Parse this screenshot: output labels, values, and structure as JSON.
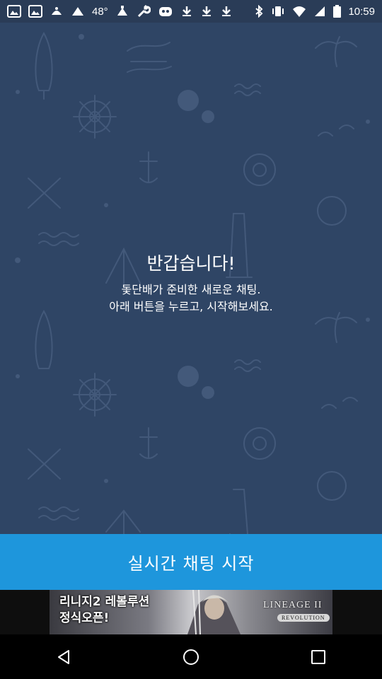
{
  "status_bar": {
    "left_icons": [
      "image-icon",
      "image-icon",
      "weather-icon",
      "weather-icon"
    ],
    "temperature": "48°",
    "more_icons": [
      "weather-icon",
      "wrench-icon",
      "mask-icon",
      "download-icon",
      "download-icon",
      "download-icon"
    ],
    "right_icons": [
      "bluetooth-icon",
      "vibrate-icon",
      "wifi-icon",
      "signal-icon",
      "battery-icon"
    ],
    "time": "10:59"
  },
  "welcome": {
    "title": "반갑습니다!",
    "line1": "돛단배가 준비한 새로운 채팅.",
    "line2": "아래 버튼을 누르고, 시작해보세요."
  },
  "start_button": {
    "label": "실시간 채팅 시작"
  },
  "ad": {
    "headline1": "리니지2 레볼루션",
    "headline2": "정식오픈!",
    "logo": "LINEAGE II",
    "logo_sub": "REVOLUTION"
  },
  "nav": {
    "icons": [
      "back-icon",
      "home-icon",
      "recents-icon"
    ]
  },
  "colors": {
    "background": "#2f4565",
    "accent": "#1e96dc",
    "pattern": "#3f5676"
  }
}
